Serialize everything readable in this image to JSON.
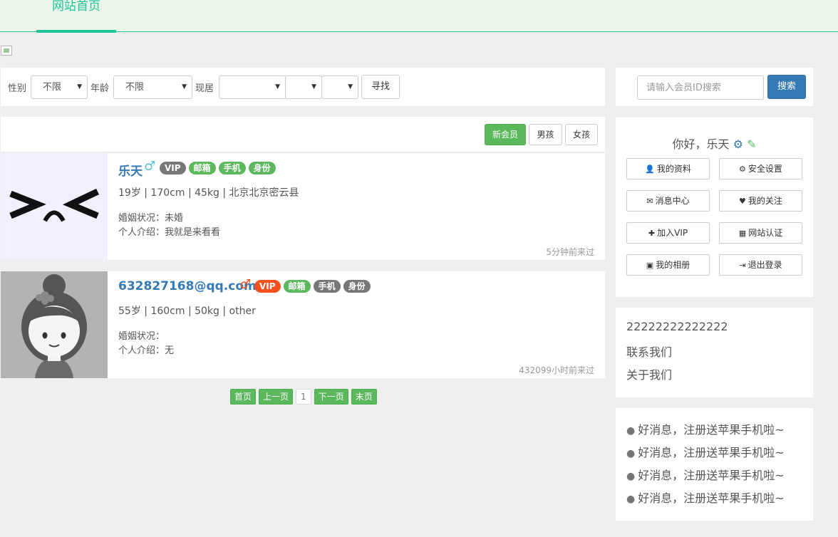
{
  "nav": {
    "home": "网站首页"
  },
  "filter": {
    "gender_label": "性别",
    "gender_value": "不限",
    "age_label": "年龄",
    "age_value": "不限",
    "residence_label": "现居",
    "province_value": "",
    "city_value": "",
    "district_value": "",
    "find_button": "寻找"
  },
  "search": {
    "placeholder": "请输入会员ID搜索",
    "button": "搜索"
  },
  "list": {
    "tabs": [
      "新会员",
      "男孩",
      "女孩"
    ],
    "active_tab": "新会员",
    "members": [
      {
        "name": "乐天",
        "sex_icon": "male-icon",
        "badges": [
          {
            "text": "VIP",
            "color": "#777777"
          },
          {
            "text": "邮箱",
            "color": "#5cb85c"
          },
          {
            "text": "手机",
            "color": "#5cb85c"
          },
          {
            "text": "身份",
            "color": "#5cb85c"
          }
        ],
        "info": "19岁 | 170cm | 45kg | 北京北京密云县",
        "marital": "婚姻状况：未婚",
        "intro": "个人介绍：我就是来看看",
        "last_seen": "5分钟前来过"
      },
      {
        "name": "632827168@qq.com",
        "sex_icon": "male-icon",
        "badges": [
          {
            "text": "VIP",
            "color": "#f4511e"
          },
          {
            "text": "邮箱",
            "color": "#5cb85c"
          },
          {
            "text": "手机",
            "color": "#777777"
          },
          {
            "text": "身份",
            "color": "#777777"
          }
        ],
        "info": "55岁 | 160cm | 50kg | other",
        "marital": "婚姻状况：",
        "intro": "个人介绍：无",
        "last_seen": "432099小时前来过"
      }
    ]
  },
  "pager": {
    "first": "首页",
    "prev": "上一页",
    "current": "1",
    "next": "下一页",
    "last": "末页"
  },
  "user": {
    "greeting": "你好，乐天",
    "buttons": [
      {
        "label": "我的资料",
        "icon": "user-icon"
      },
      {
        "label": "安全设置",
        "icon": "gear-icon"
      },
      {
        "label": "消息中心",
        "icon": "envelope-icon"
      },
      {
        "label": "我的关注",
        "icon": "heart-icon"
      },
      {
        "label": "加入VIP",
        "icon": "gift-icon"
      },
      {
        "label": "网站认证",
        "icon": "qrcode-icon"
      },
      {
        "label": "我的相册",
        "icon": "picture-icon"
      },
      {
        "label": "退出登录",
        "icon": "logout-icon"
      }
    ]
  },
  "links": [
    "22222222222222",
    "联系我们",
    "关于我们"
  ],
  "news": [
    "好消息，注册送苹果手机啦~",
    "好消息，注册送苹果手机啦~",
    "好消息，注册送苹果手机啦~",
    "好消息，注册送苹果手机啦~"
  ],
  "colors": {
    "accent": "#22c39a",
    "primary": "#337ab7",
    "success": "#5cb85c",
    "vip_red": "#f4511e"
  }
}
